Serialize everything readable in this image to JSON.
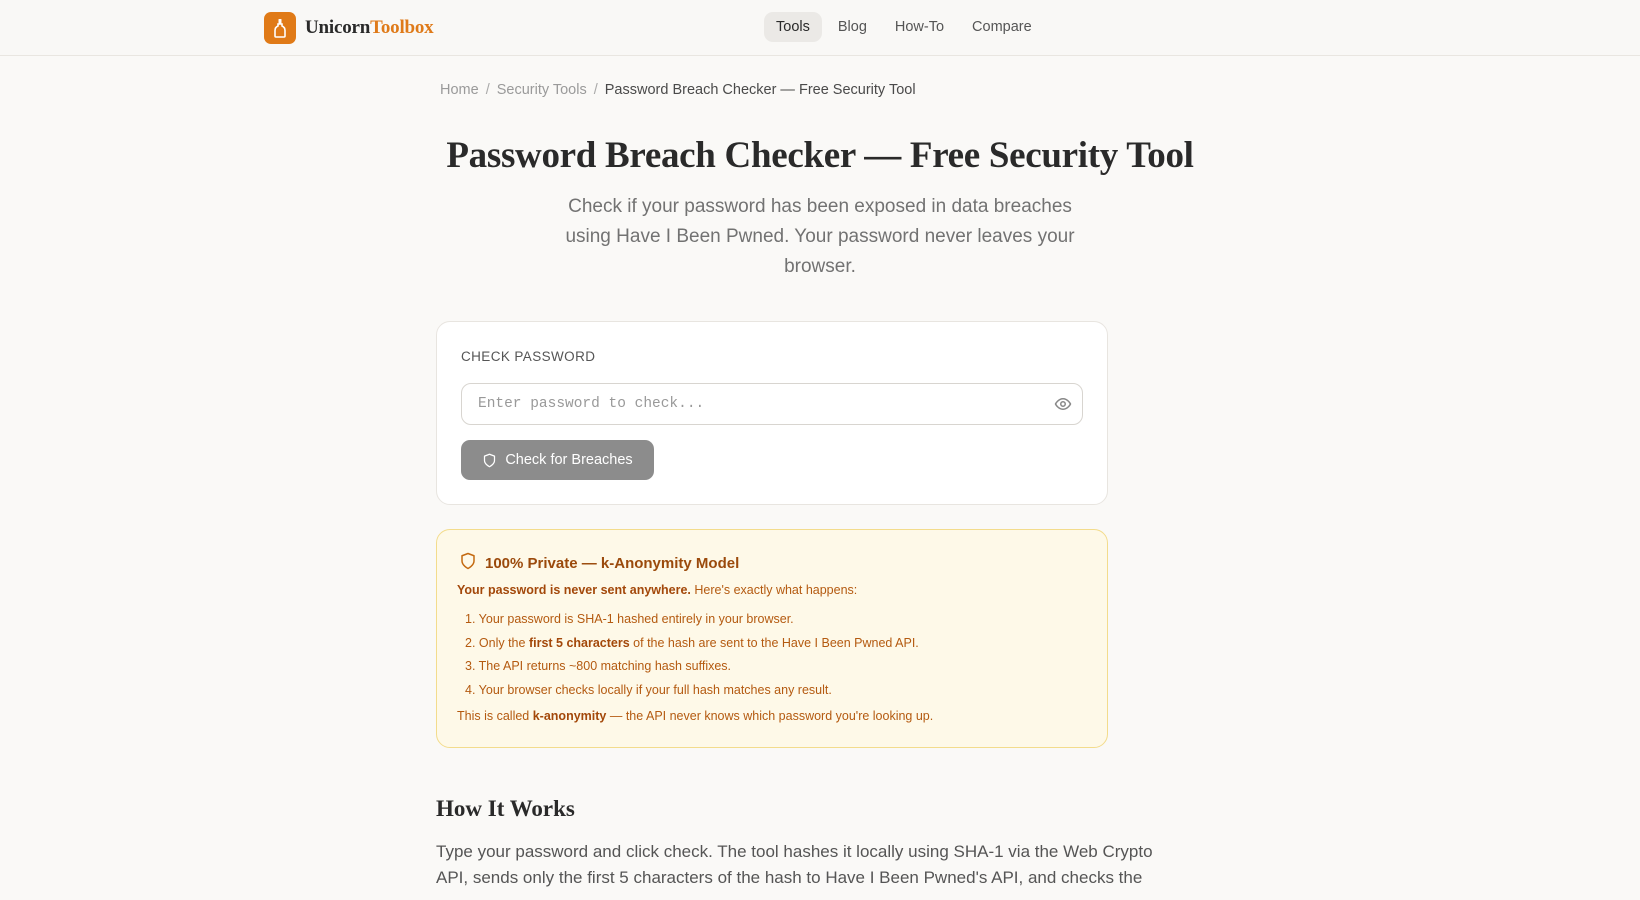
{
  "header": {
    "logo_part1": "Unicorn",
    "logo_part2": "Toolbox",
    "nav": [
      "Tools",
      "Blog",
      "How-To",
      "Compare"
    ]
  },
  "breadcrumb": [
    "Home",
    "Security Tools",
    "Password Breach Checker — Free Security Tool"
  ],
  "page": {
    "title": "Password Breach Checker — Free Security Tool",
    "subtitle": "Check if your password has been exposed in data breaches using Have I Been Pwned. Your password never leaves your browser."
  },
  "check_card": {
    "label": "CHECK PASSWORD",
    "input_placeholder": "Enter password to check...",
    "input_value": "",
    "button_label": "Check for Breaches"
  },
  "privacy_notice": {
    "title": "100% Private — k-Anonymity Model",
    "intro_bold": "Your password is never sent anywhere.",
    "intro_rest": " Here's exactly what happens:",
    "step1": "1. Your password is SHA-1 hashed entirely in your browser.",
    "step2_pre": "2. Only the ",
    "step2_bold": "first 5 characters",
    "step2_post": " of the hash are sent to the Have I Been Pwned API.",
    "step3": "3. The API returns ~800 matching hash suffixes.",
    "step4": "4. Your browser checks locally if your full hash matches any result.",
    "footer_pre": "This is called ",
    "footer_bold": "k-anonymity",
    "footer_post": " — the API never knows which password you're looking up."
  },
  "how_it_works": {
    "title": "How It Works",
    "text": "Type your password and click check. The tool hashes it locally using SHA-1 via the Web Crypto API, sends only the first 5 characters of the hash to Have I Been Pwned's API, and checks the response"
  },
  "colors": {
    "brand": "#e07a17",
    "notice_bg": "#fef9e8",
    "notice_border": "#f3dc8c",
    "button_bg": "#8c8c8c"
  }
}
